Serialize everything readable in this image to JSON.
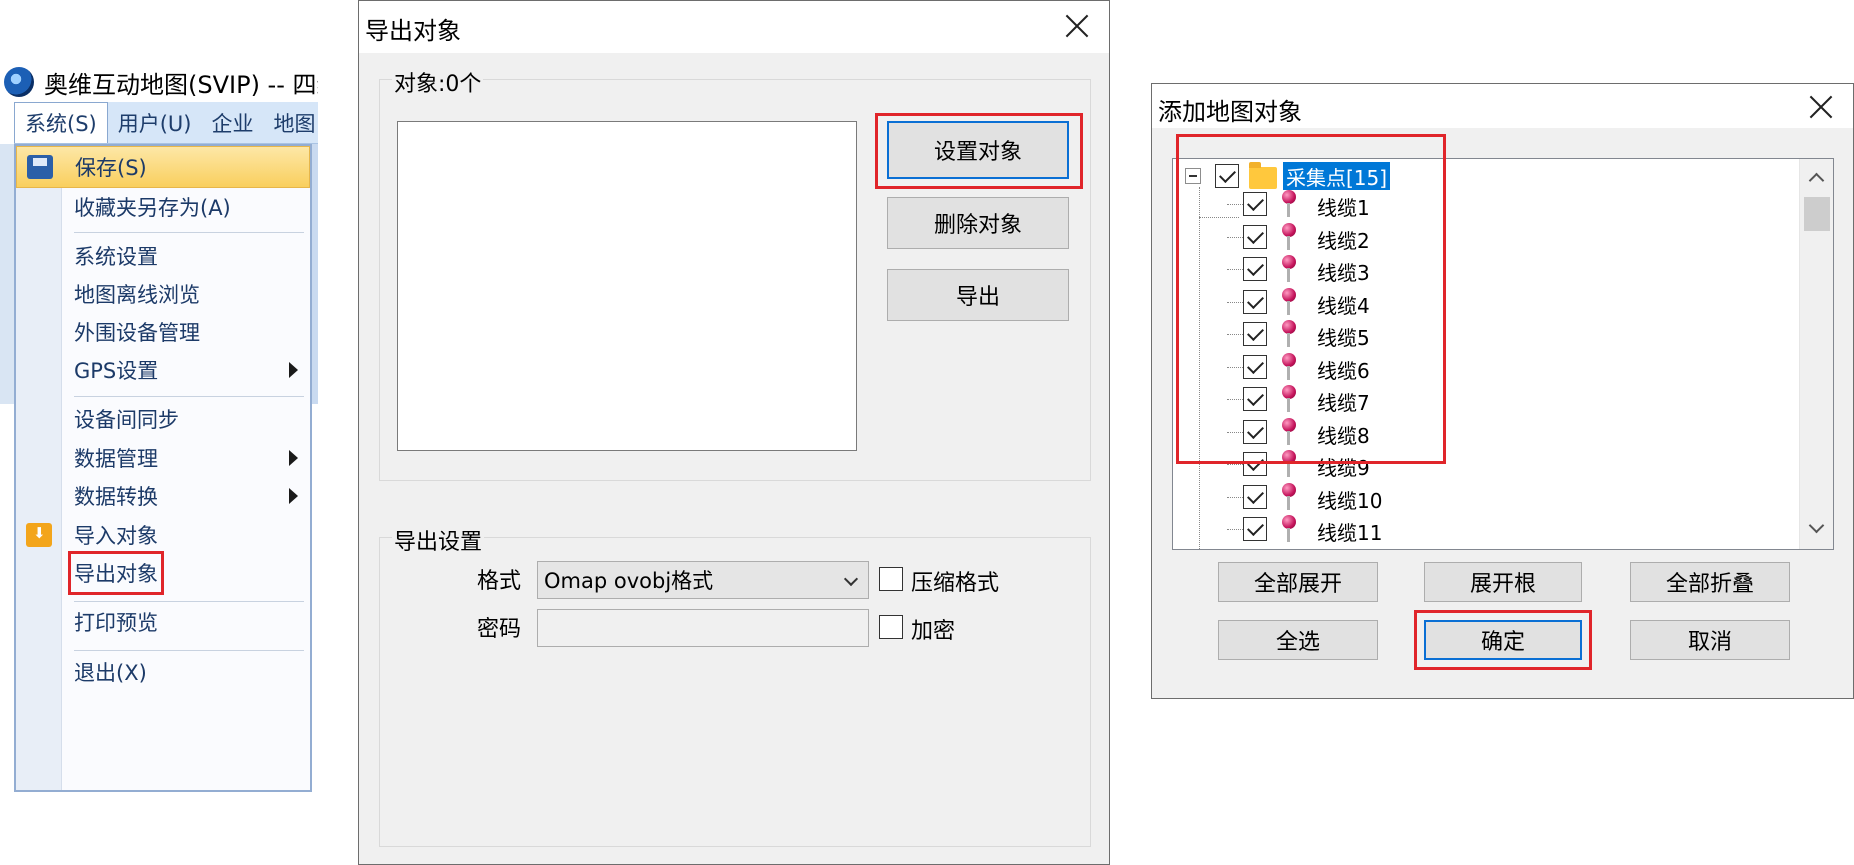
{
  "app": {
    "title": "奥维互动地图(SVIP) -- 四维",
    "menubar": [
      "系统(S)",
      "用户(U)",
      "企业",
      "地图"
    ],
    "system_menu": {
      "items": [
        {
          "label": "保存(S)",
          "icon": "save-icon",
          "highlighted": true
        },
        {
          "label": "收藏夹另存为(A)"
        },
        {
          "label": "系统设置"
        },
        {
          "label": "地图离线浏览"
        },
        {
          "label": "外围设备管理"
        },
        {
          "label": "GPS设置",
          "submenu": true
        },
        {
          "label": "设备间同步"
        },
        {
          "label": "数据管理",
          "submenu": true
        },
        {
          "label": "数据转换",
          "submenu": true
        },
        {
          "label": "导入对象",
          "icon": "import-icon"
        },
        {
          "label": "导出对象",
          "annotated": true
        },
        {
          "label": "打印预览"
        },
        {
          "label": "退出(X)"
        }
      ]
    }
  },
  "export_dialog": {
    "title": "导出对象",
    "objects_group": "对象:0个",
    "buttons": {
      "set_objects": "设置对象",
      "delete_objects": "删除对象",
      "export": "导出"
    },
    "settings_group": "导出设置",
    "format_label": "格式",
    "format_value": "Omap ovobj格式",
    "compress_label": "压缩格式",
    "compress_checked": false,
    "password_label": "密码",
    "password_value": "",
    "encrypt_label": "加密",
    "encrypt_checked": false
  },
  "add_dialog": {
    "title": "添加地图对象",
    "tree_root": {
      "label": "采集点[15]",
      "checked": true,
      "expanded": true
    },
    "tree_items": [
      "线缆1",
      "线缆2",
      "线缆3",
      "线缆4",
      "线缆5",
      "线缆6",
      "线缆7",
      "线缆8",
      "线缆9",
      "线缆10",
      "线缆11"
    ],
    "buttons": {
      "expand_all": "全部展开",
      "expand_root": "展开根",
      "collapse_all": "全部折叠",
      "select_all": "全选",
      "ok": "确定",
      "cancel": "取消"
    }
  },
  "colors": {
    "annotation_red": "#e0252a",
    "selection_blue": "#0078d7",
    "focus_blue": "#0a6fd4"
  }
}
